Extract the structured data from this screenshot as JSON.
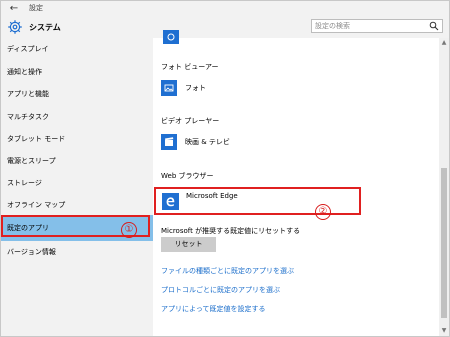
{
  "titlebar": {
    "back_icon": "←",
    "title": "設定"
  },
  "header": {
    "title": "システム",
    "search_placeholder": "設定の検索"
  },
  "sidebar": {
    "items": [
      {
        "label": "ディスプレイ"
      },
      {
        "label": "通知と操作"
      },
      {
        "label": "アプリと機能"
      },
      {
        "label": "マルチタスク"
      },
      {
        "label": "タブレット モード"
      },
      {
        "label": "電源とスリープ"
      },
      {
        "label": "ストレージ"
      },
      {
        "label": "オフライン マップ"
      },
      {
        "label": "既定のアプリ"
      },
      {
        "label": "バージョン情報"
      }
    ],
    "selected_index": 8
  },
  "main": {
    "sections": {
      "photo_viewer": {
        "label": "フォト ビューアー",
        "app": "フォト"
      },
      "video_player": {
        "label": "ビデオ プレーヤー",
        "app": "映画 & テレビ"
      },
      "web_browser": {
        "label": "Web ブラウザー",
        "app": "Microsoft Edge"
      }
    },
    "reset": {
      "label": "Microsoft が推奨する既定値にリセットする",
      "button": "リセット"
    },
    "links": [
      "ファイルの種類ごとに既定のアプリを選ぶ",
      "プロトコルごとに既定のアプリを選ぶ",
      "アプリによって既定値を設定する"
    ]
  },
  "annotations": {
    "marker_1": "①",
    "marker_2": "②"
  },
  "colors": {
    "accent": "#1f6fd1",
    "selected": "#84bfe9",
    "highlight_red": "#e02020",
    "link": "#1b6ecb"
  }
}
